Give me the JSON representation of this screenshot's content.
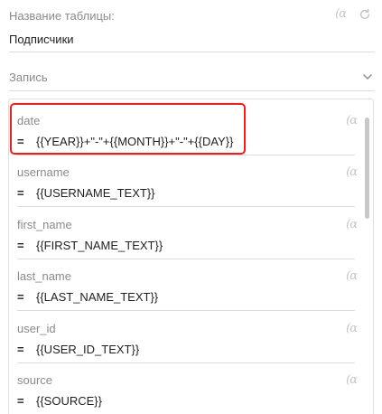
{
  "header": {
    "table_name_label": "Название таблицы:",
    "table_name_value": "Подписчики",
    "variable_icon": "(α",
    "reset_icon": "refresh-icon"
  },
  "record": {
    "label": "Запись",
    "toggle_icon": "chevron-down-icon"
  },
  "fields": [
    {
      "name": "date",
      "operator": "=",
      "value": "{{YEAR}}+\"-\"+{{MONTH}}+\"-\"+{{DAY}}",
      "icon": "(α"
    },
    {
      "name": "username",
      "operator": "=",
      "value": "{{USERNAME_TEXT}}",
      "icon": "(α"
    },
    {
      "name": "first_name",
      "operator": "=",
      "value": "{{FIRST_NAME_TEXT}}",
      "icon": "(α"
    },
    {
      "name": "last_name",
      "operator": "=",
      "value": "{{LAST_NAME_TEXT}}",
      "icon": "(α"
    },
    {
      "name": "user_id",
      "operator": "=",
      "value": "{{USER_ID_TEXT}}",
      "icon": "(α"
    },
    {
      "name": "source",
      "operator": "=",
      "value": "{{SOURCE}}",
      "icon": "(α"
    }
  ],
  "colors": {
    "highlight": "#e02424",
    "muted_text": "#8a8a8a",
    "border": "#dcdcdc"
  }
}
